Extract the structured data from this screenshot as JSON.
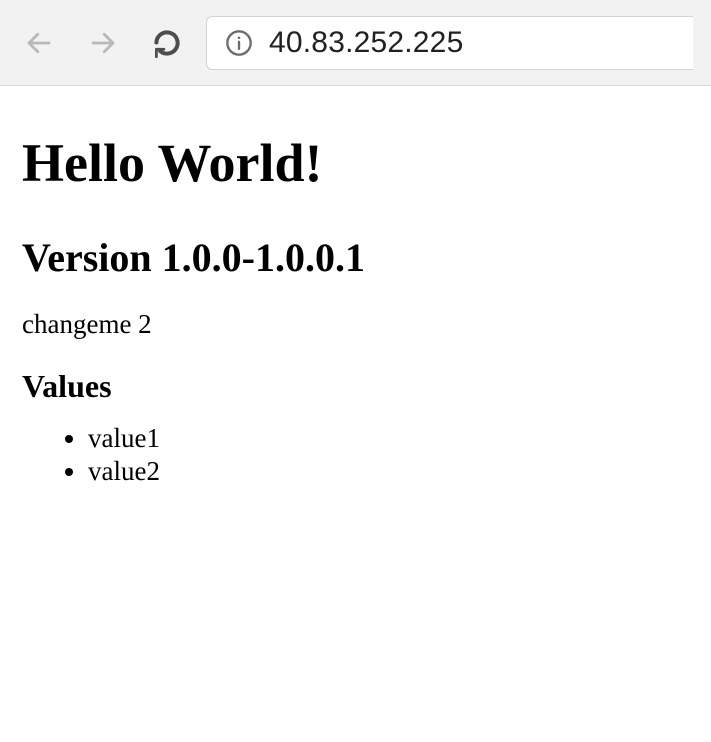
{
  "toolbar": {
    "address": "40.83.252.225"
  },
  "page": {
    "heading": "Hello World!",
    "version_heading": "Version 1.0.0-1.0.0.1",
    "change_text": "changeme 2",
    "values_heading": "Values",
    "values": [
      "value1",
      "value2"
    ]
  }
}
